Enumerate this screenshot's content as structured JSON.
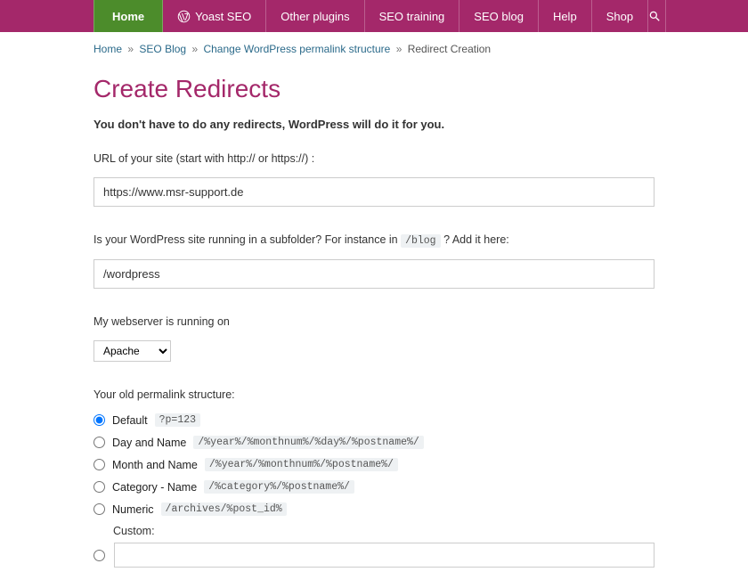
{
  "nav": {
    "home": "Home",
    "yoast": "Yoast SEO",
    "other": "Other plugins",
    "training": "SEO training",
    "blog": "SEO blog",
    "help": "Help",
    "shop": "Shop"
  },
  "breadcrumb": {
    "home": "Home",
    "seo_blog": "SEO Blog",
    "change": "Change WordPress permalink structure",
    "current": "Redirect Creation",
    "sep": "»"
  },
  "heading": "Create Redirects",
  "subheading": "You don't have to do any redirects, WordPress will do it for you.",
  "url_label": "URL of your site (start with http:// or https://) :",
  "url_value": "https://www.msr-support.de",
  "subfolder_label_pre": "Is your WordPress site running in a subfolder? For instance in ",
  "subfolder_code": "/blog",
  "subfolder_label_post": " ? Add it here:",
  "subfolder_value": "/wordpress",
  "webserver_label": "My webserver is running on",
  "webserver_options": [
    "Apache"
  ],
  "permalink_label": "Your old permalink structure:",
  "permalink": {
    "default_label": "Default",
    "default_code": "?p=123",
    "dayname_label": "Day and Name",
    "dayname_code": "/%year%/%monthnum%/%day%/%postname%/",
    "monthname_label": "Month and Name",
    "monthname_code": "/%year%/%monthnum%/%postname%/",
    "category_label": "Category - Name",
    "category_code": "/%category%/%postname%/",
    "numeric_label": "Numeric",
    "numeric_code": "/archives/%post_id%",
    "custom_label": "Custom:",
    "custom_value": ""
  }
}
